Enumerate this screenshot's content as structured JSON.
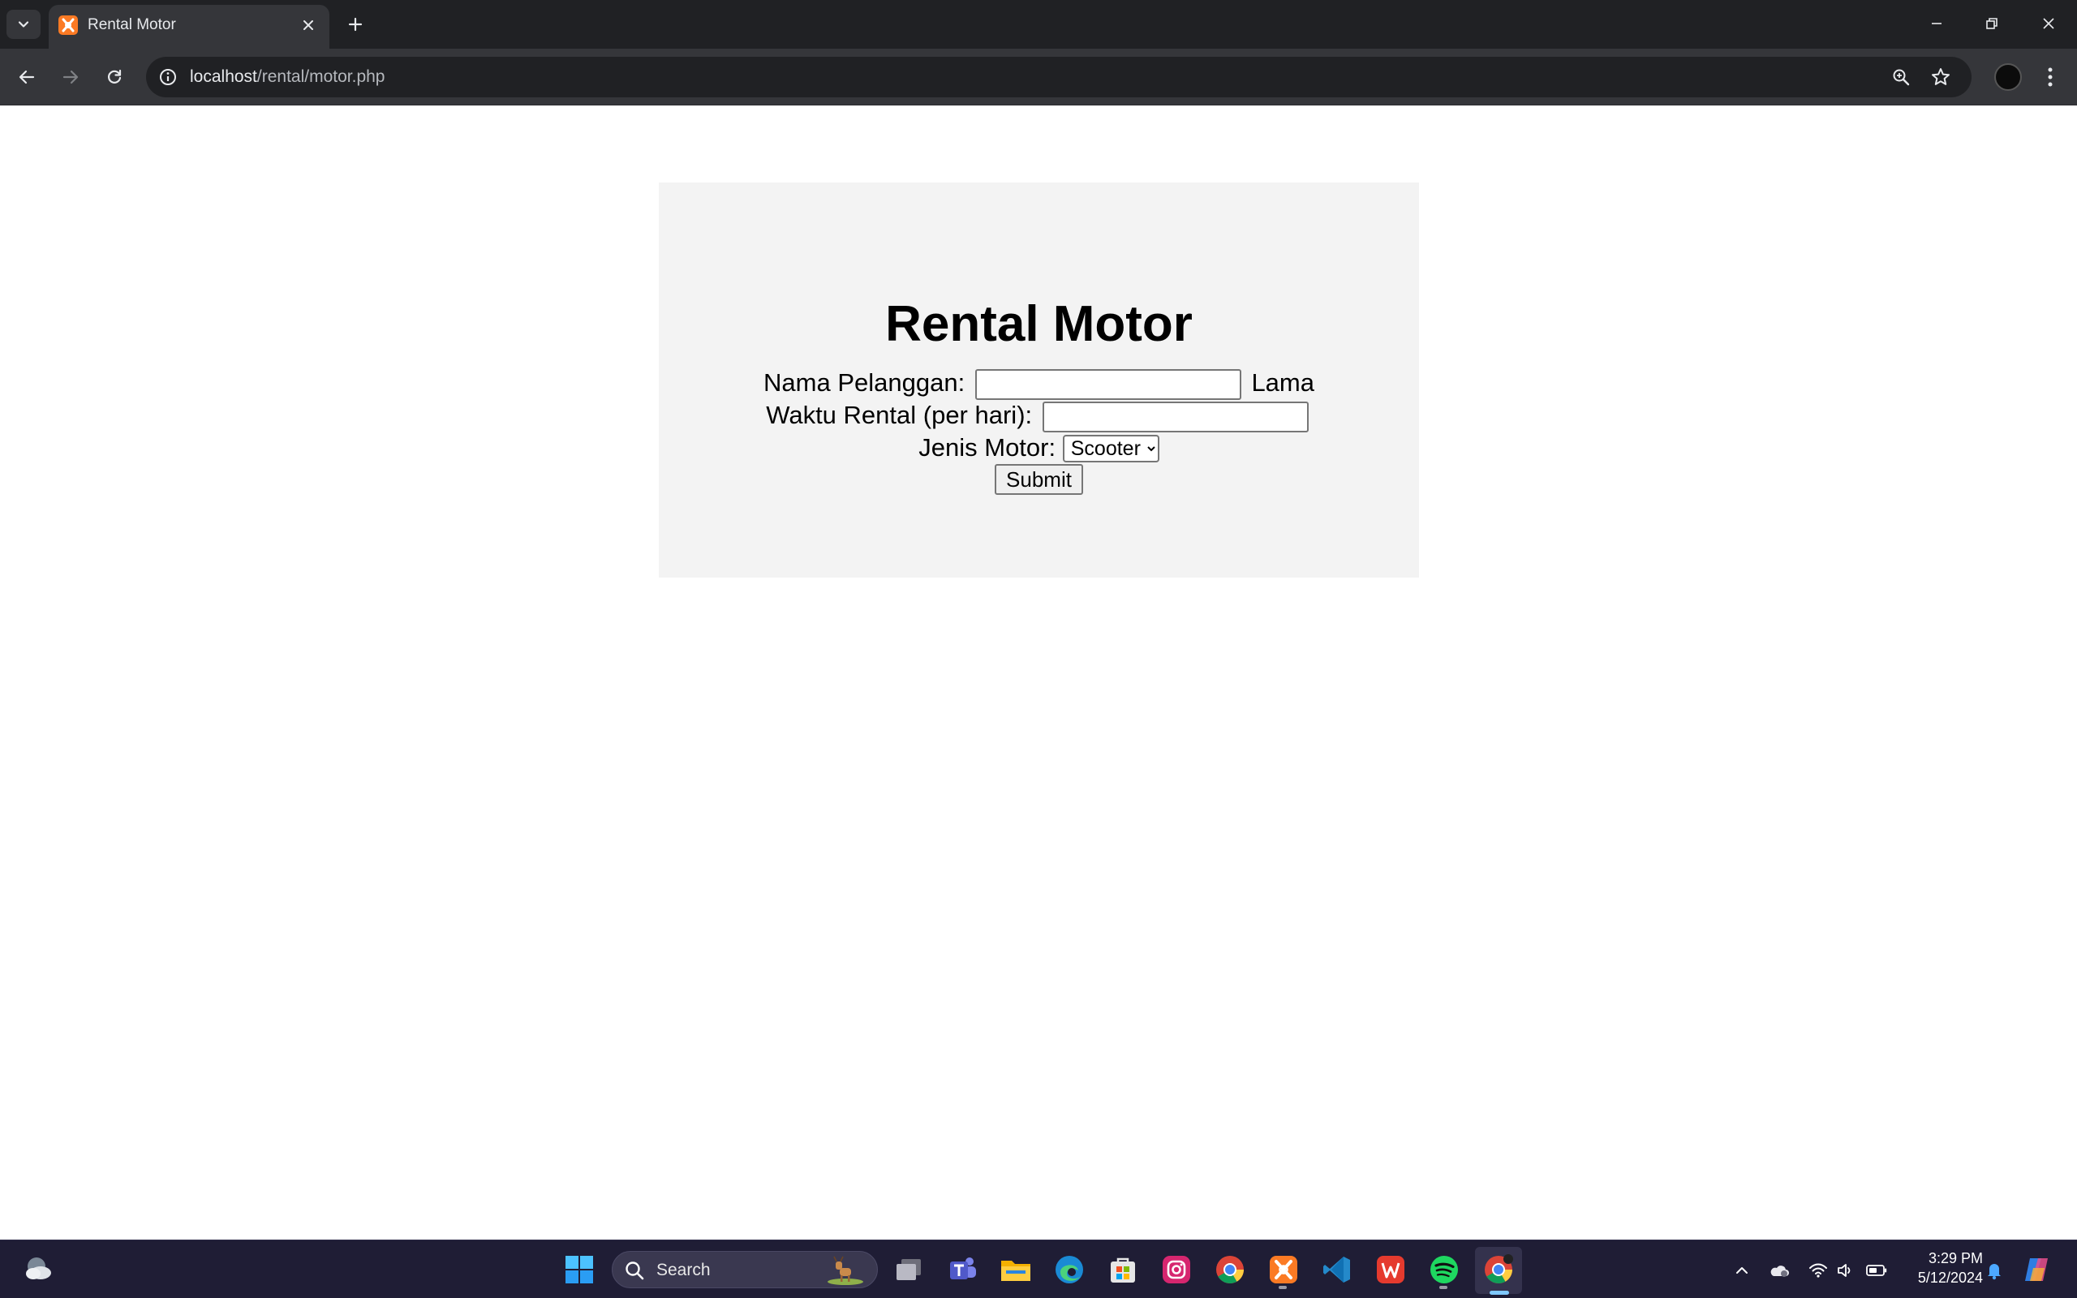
{
  "browser": {
    "tab": {
      "title": "Rental Motor"
    },
    "address_bar": {
      "host": "localhost",
      "path": "/rental/motor.php"
    }
  },
  "page": {
    "heading": "Rental Motor",
    "form": {
      "nama_label": "Nama Pelanggan:",
      "nama_value": "",
      "lama_label": "Lama Waktu Rental (per hari):",
      "lama_value": "",
      "jenis_label": "Jenis Motor:",
      "jenis_selected": "Scooter",
      "submit_label": "Submit"
    }
  },
  "taskbar": {
    "search_label": "Search",
    "apps": [
      "task-view",
      "teams",
      "file-explorer",
      "edge",
      "microsoft-store",
      "instagram",
      "chrome",
      "xampp",
      "vscode",
      "wps-office",
      "spotify",
      "chrome-active"
    ],
    "clock": {
      "time": "3:29 PM",
      "date": "5/12/2024"
    }
  },
  "colors": {
    "tabstrip": "#202124",
    "toolbar": "#35363a",
    "form_card": "#f3f3f3",
    "taskbar": "#1f1d35",
    "xampp_orange": "#fb7a24"
  }
}
